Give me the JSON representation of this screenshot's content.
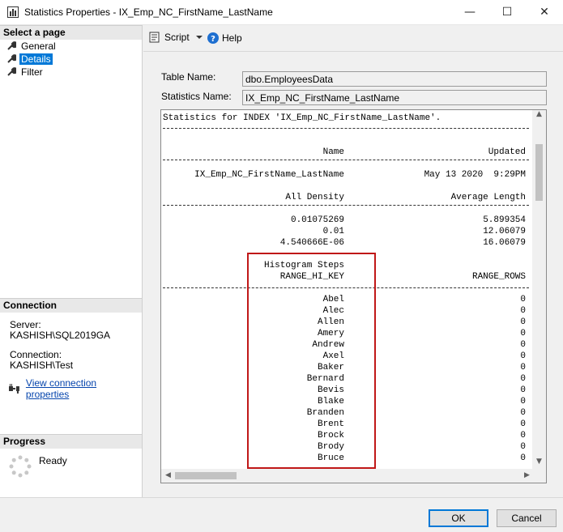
{
  "window": {
    "title": "Statistics Properties - IX_Emp_NC_FirstName_LastName",
    "minimize_glyph": "—",
    "maximize_glyph": "☐",
    "close_glyph": "✕"
  },
  "left_pane": {
    "select_page_header": "Select a page",
    "pages": [
      {
        "label": "General",
        "icon": "wrench-icon"
      },
      {
        "label": "Details",
        "icon": "wrench-icon",
        "selected": true
      },
      {
        "label": "Filter",
        "icon": "wrench-icon"
      }
    ],
    "connection_header": "Connection",
    "server_label": "Server:",
    "server_value": "KASHISH\\SQL2019GA",
    "connection_label": "Connection:",
    "connection_value": "KASHISH\\Test",
    "connection_link": "View connection properties",
    "progress_header": "Progress",
    "progress_status": "Ready"
  },
  "toolbar": {
    "script_label": "Script",
    "help_label": "Help"
  },
  "form": {
    "table_name_label": "Table Name:",
    "table_name_value": "dbo.EmployeesData",
    "statistics_name_label": "Statistics Name:",
    "statistics_name_value": "IX_Emp_NC_FirstName_LastName"
  },
  "results": {
    "heading": "Statistics for INDEX 'IX_Emp_NC_FirstName_LastName'.",
    "header_name": "Name",
    "header_updated": "Updated",
    "row_name": "IX_Emp_NC_FirstName_LastName",
    "row_updated": "May 13 2020  9:29PM",
    "header_all_density": "All Density",
    "header_average_length": "Average Length",
    "density_rows": [
      {
        "density": "0.01075269",
        "length": "5.899354"
      },
      {
        "density": "0.01",
        "length": "12.06079"
      },
      {
        "density": "4.540666E-06",
        "length": "16.06079"
      }
    ],
    "histogram_title": "Histogram Steps",
    "header_range_hi_key": "RANGE_HI_KEY",
    "header_range_rows": "RANGE_ROWS",
    "histogram_rows": [
      {
        "key": "Abel",
        "rows": "0"
      },
      {
        "key": "Alec",
        "rows": "0"
      },
      {
        "key": "Allen",
        "rows": "0"
      },
      {
        "key": "Amery",
        "rows": "0"
      },
      {
        "key": "Andrew",
        "rows": "0"
      },
      {
        "key": "Axel",
        "rows": "0"
      },
      {
        "key": "Baker",
        "rows": "0"
      },
      {
        "key": "Bernard",
        "rows": "0"
      },
      {
        "key": "Bevis",
        "rows": "0"
      },
      {
        "key": "Blake",
        "rows": "0"
      },
      {
        "key": "Branden",
        "rows": "0"
      },
      {
        "key": "Brent",
        "rows": "0"
      },
      {
        "key": "Brock",
        "rows": "0"
      },
      {
        "key": "Brody",
        "rows": "0"
      },
      {
        "key": "Bruce",
        "rows": "0"
      }
    ],
    "highlight_color": "#c01818"
  },
  "buttons": {
    "ok": "OK",
    "cancel": "Cancel"
  }
}
